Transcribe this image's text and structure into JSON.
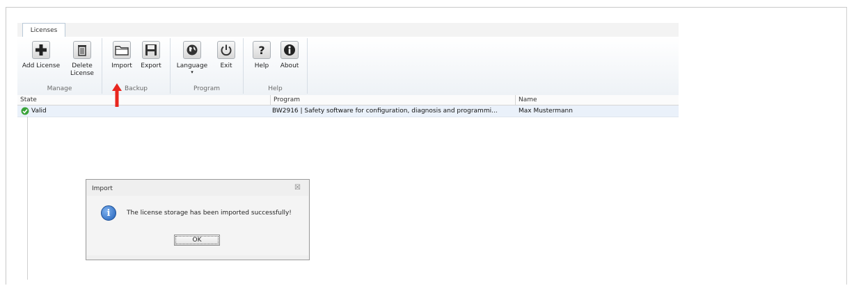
{
  "tab": {
    "label": "Licenses"
  },
  "ribbon": {
    "groups": [
      {
        "label": "Manage",
        "buttons": [
          {
            "label": "Add License",
            "icon": "plus-icon"
          },
          {
            "label": "Delete\nLicense",
            "icon": "trash-icon"
          }
        ]
      },
      {
        "label": "Backup",
        "buttons": [
          {
            "label": "Import",
            "icon": "folder-icon"
          },
          {
            "label": "Export",
            "icon": "floppy-disk-icon"
          }
        ]
      },
      {
        "label": "Program",
        "buttons": [
          {
            "label": "Language",
            "icon": "globe-icon",
            "dropdown": "▾"
          },
          {
            "label": "Exit",
            "icon": "power-icon"
          }
        ]
      },
      {
        "label": "Help",
        "buttons": [
          {
            "label": "Help",
            "icon": "question-icon"
          },
          {
            "label": "About",
            "icon": "info-icon"
          }
        ]
      }
    ]
  },
  "table": {
    "columns": [
      "State",
      "Program",
      "Name"
    ],
    "rows": [
      {
        "state": "Valid",
        "program": "BW2916 | Safety software for configuration, diagnosis and programmi...",
        "name": "Max Mustermann"
      }
    ]
  },
  "dialog": {
    "title": "Import",
    "close": "☒",
    "message": "The license storage has been imported successfully!",
    "ok": "OK"
  },
  "colors": {
    "status_valid": "#3aa33a",
    "arrow": "#e8261f",
    "info": "#1f5fb8"
  }
}
